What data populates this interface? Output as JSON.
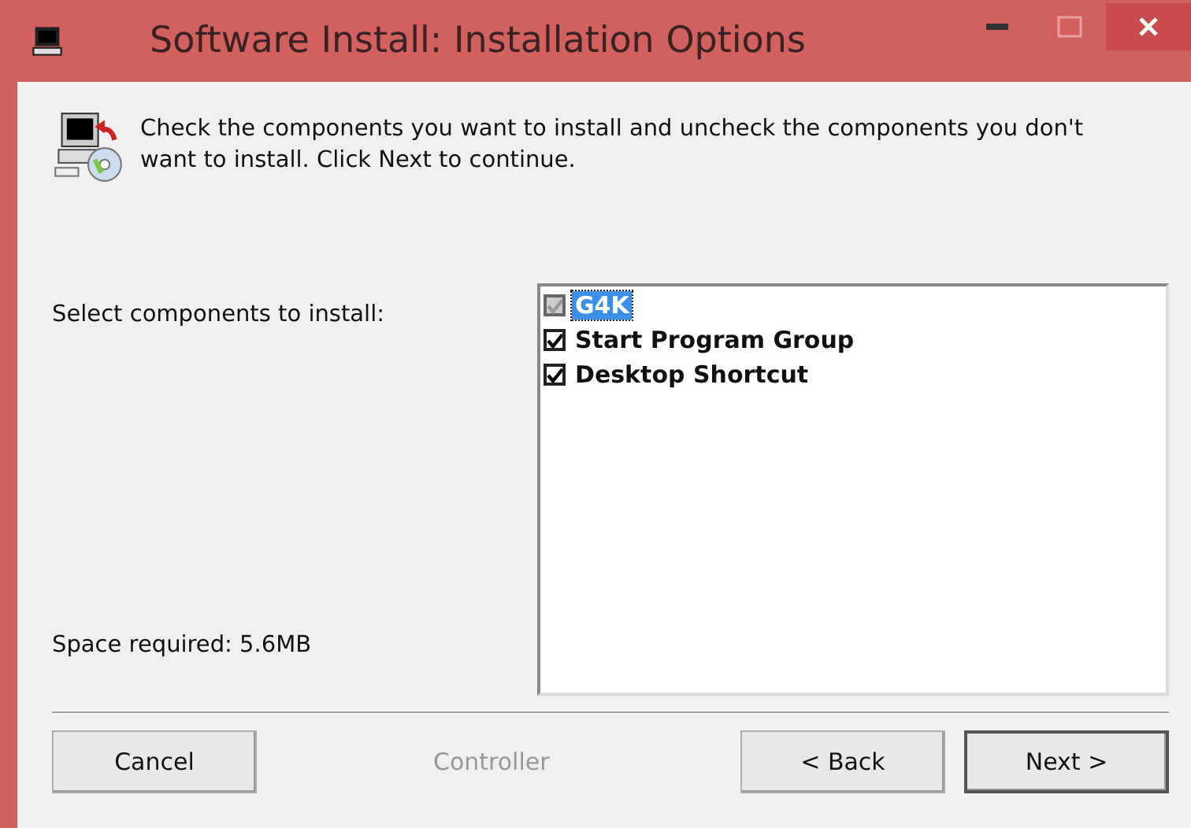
{
  "window": {
    "title": "Software Install: Installation Options"
  },
  "description": "Check the components you want to install and uncheck the components you don't want to install. Click Next to continue.",
  "select_label": "Select components to install:",
  "components": [
    {
      "label": "G4K",
      "checked": true,
      "disabled": true,
      "selected": true
    },
    {
      "label": "Start Program Group",
      "checked": true,
      "disabled": false,
      "selected": false
    },
    {
      "label": "Desktop Shortcut",
      "checked": true,
      "disabled": false,
      "selected": false
    }
  ],
  "space_required": "Space required: 5.6MB",
  "brand": "Controller",
  "buttons": [
    {
      "label": "Cancel",
      "default": false
    },
    {
      "label": "< Back",
      "default": false
    },
    {
      "label": "Next >",
      "default": true
    }
  ]
}
